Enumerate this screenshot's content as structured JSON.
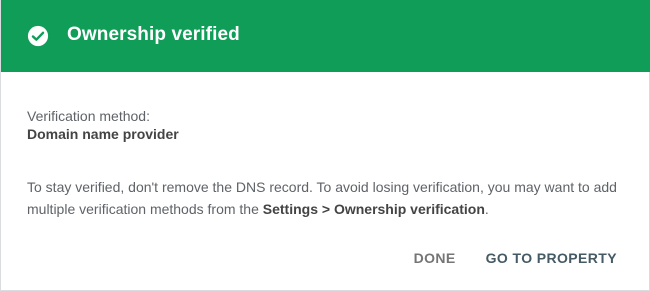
{
  "header": {
    "title": "Ownership verified",
    "icon": "check-circle-icon",
    "background_color": "#0f9d58"
  },
  "method": {
    "label": "Verification method:",
    "value": "Domain name provider"
  },
  "description": {
    "text_before": "To stay verified, don't remove the DNS record. To avoid losing verification, you may want to add multiple verification methods from the ",
    "link_text": "Settings > Ownership verification",
    "text_after": "."
  },
  "actions": {
    "done_label": "DONE",
    "go_label": "GO TO PROPERTY"
  }
}
